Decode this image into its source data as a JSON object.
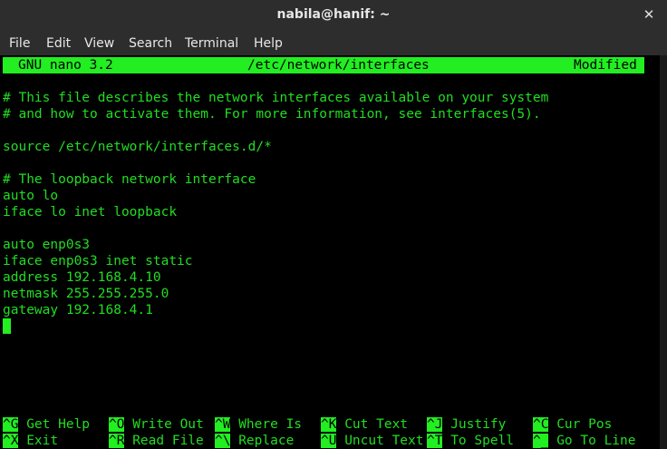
{
  "window": {
    "title": "nabila@hanif: ~",
    "close_glyph": "✕"
  },
  "menu": [
    "File",
    "Edit",
    "View",
    "Search",
    "Terminal",
    "Help"
  ],
  "nano": {
    "version": "GNU nano 3.2",
    "file": "/etc/network/interfaces",
    "status": "Modified"
  },
  "lines": [
    "# This file describes the network interfaces available on your system",
    "# and how to activate them. For more information, see interfaces(5).",
    "",
    "source /etc/network/interfaces.d/*",
    "",
    "# The loopback network interface",
    "auto lo",
    "iface lo inet loopback",
    "",
    "auto enp0s3",
    "iface enp0s3 inet static",
    "address 192.168.4.10",
    "netmask 255.255.255.0",
    "gateway 192.168.4.1"
  ],
  "shortcuts": [
    [
      {
        "key": "^G",
        "label": "Get Help"
      },
      {
        "key": "^O",
        "label": "Write Out"
      },
      {
        "key": "^W",
        "label": "Where Is"
      },
      {
        "key": "^K",
        "label": "Cut Text"
      },
      {
        "key": "^J",
        "label": "Justify"
      },
      {
        "key": "^C",
        "label": "Cur Pos"
      }
    ],
    [
      {
        "key": "^X",
        "label": "Exit"
      },
      {
        "key": "^R",
        "label": "Read File"
      },
      {
        "key": "^\\",
        "label": "Replace"
      },
      {
        "key": "^U",
        "label": "Uncut Text"
      },
      {
        "key": "^T",
        "label": "To Spell"
      },
      {
        "key": "^_",
        "label": "Go To Line"
      }
    ]
  ],
  "colors": {
    "accent": "#22ee22",
    "background": "#000000",
    "titlebar": "#2d2d2d"
  }
}
